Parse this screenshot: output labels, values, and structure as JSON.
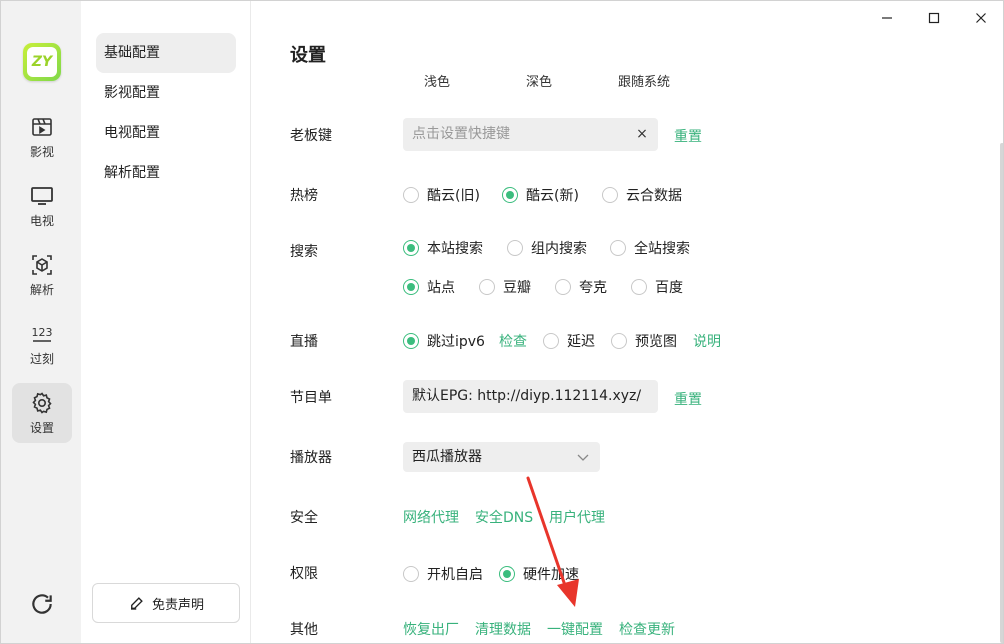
{
  "app": {
    "logo_text": "ZY"
  },
  "rail": {
    "items": [
      {
        "label": "影视",
        "icon": "film-clapper-icon"
      },
      {
        "label": "电视",
        "icon": "tv-icon"
      },
      {
        "label": "解析",
        "icon": "scan-cube-icon"
      },
      {
        "label": "过刻",
        "icon": "numbers-123-icon",
        "glyph": "123"
      },
      {
        "label": "设置",
        "icon": "gear-icon",
        "active": true
      }
    ],
    "bottom_icon": "refresh-icon"
  },
  "subnav": {
    "items": [
      {
        "label": "基础配置",
        "active": true
      },
      {
        "label": "影视配置"
      },
      {
        "label": "电视配置"
      },
      {
        "label": "解析配置"
      }
    ],
    "disclaimer_label": "免责声明"
  },
  "window_controls": {
    "minimize": "minimize-icon",
    "maximize": "maximize-icon",
    "close": "close-icon"
  },
  "main": {
    "title": "设置",
    "theme_options": [
      "浅色",
      "深色",
      "跟随系统"
    ],
    "boss_key": {
      "label": "老板键",
      "placeholder": "点击设置快捷键",
      "clear_glyph": "×",
      "reset_link": "重置"
    },
    "hot": {
      "label": "热榜",
      "options": [
        {
          "label": "酷云(旧)",
          "checked": false
        },
        {
          "label": "酷云(新)",
          "checked": true
        },
        {
          "label": "云合数据",
          "checked": false
        }
      ]
    },
    "search": {
      "label": "搜索",
      "scope_options": [
        {
          "label": "本站搜索",
          "checked": true
        },
        {
          "label": "组内搜索",
          "checked": false
        },
        {
          "label": "全站搜索",
          "checked": false
        }
      ],
      "source_options": [
        {
          "label": "站点",
          "checked": true
        },
        {
          "label": "豆瓣",
          "checked": false
        },
        {
          "label": "夸克",
          "checked": false
        },
        {
          "label": "百度",
          "checked": false
        }
      ]
    },
    "live": {
      "label": "直播",
      "skip_ipv6": {
        "label": "跳过ipv6",
        "checked": true
      },
      "check_link": "检查",
      "delay": {
        "label": "延迟",
        "checked": false
      },
      "preview": {
        "label": "预览图",
        "checked": false
      },
      "explain_link": "说明"
    },
    "epg": {
      "label": "节目单",
      "value": "默认EPG:  http://diyp.112114.xyz/",
      "reset_link": "重置"
    },
    "player": {
      "label": "播放器",
      "selected": "西瓜播放器"
    },
    "security": {
      "label": "安全",
      "links": [
        "网络代理",
        "安全DNS",
        "用户代理"
      ]
    },
    "permission": {
      "label": "权限",
      "autostart": {
        "label": "开机自启",
        "checked": false
      },
      "hw_accel": {
        "label": "硬件加速",
        "checked": true
      }
    },
    "other": {
      "label": "其他",
      "links": [
        "恢复出厂",
        "清理数据",
        "一键配置",
        "检查更新"
      ]
    }
  },
  "colors": {
    "accent": "#3bbd7e",
    "link": "#38b27c",
    "annotation_arrow": "#e8352b"
  }
}
